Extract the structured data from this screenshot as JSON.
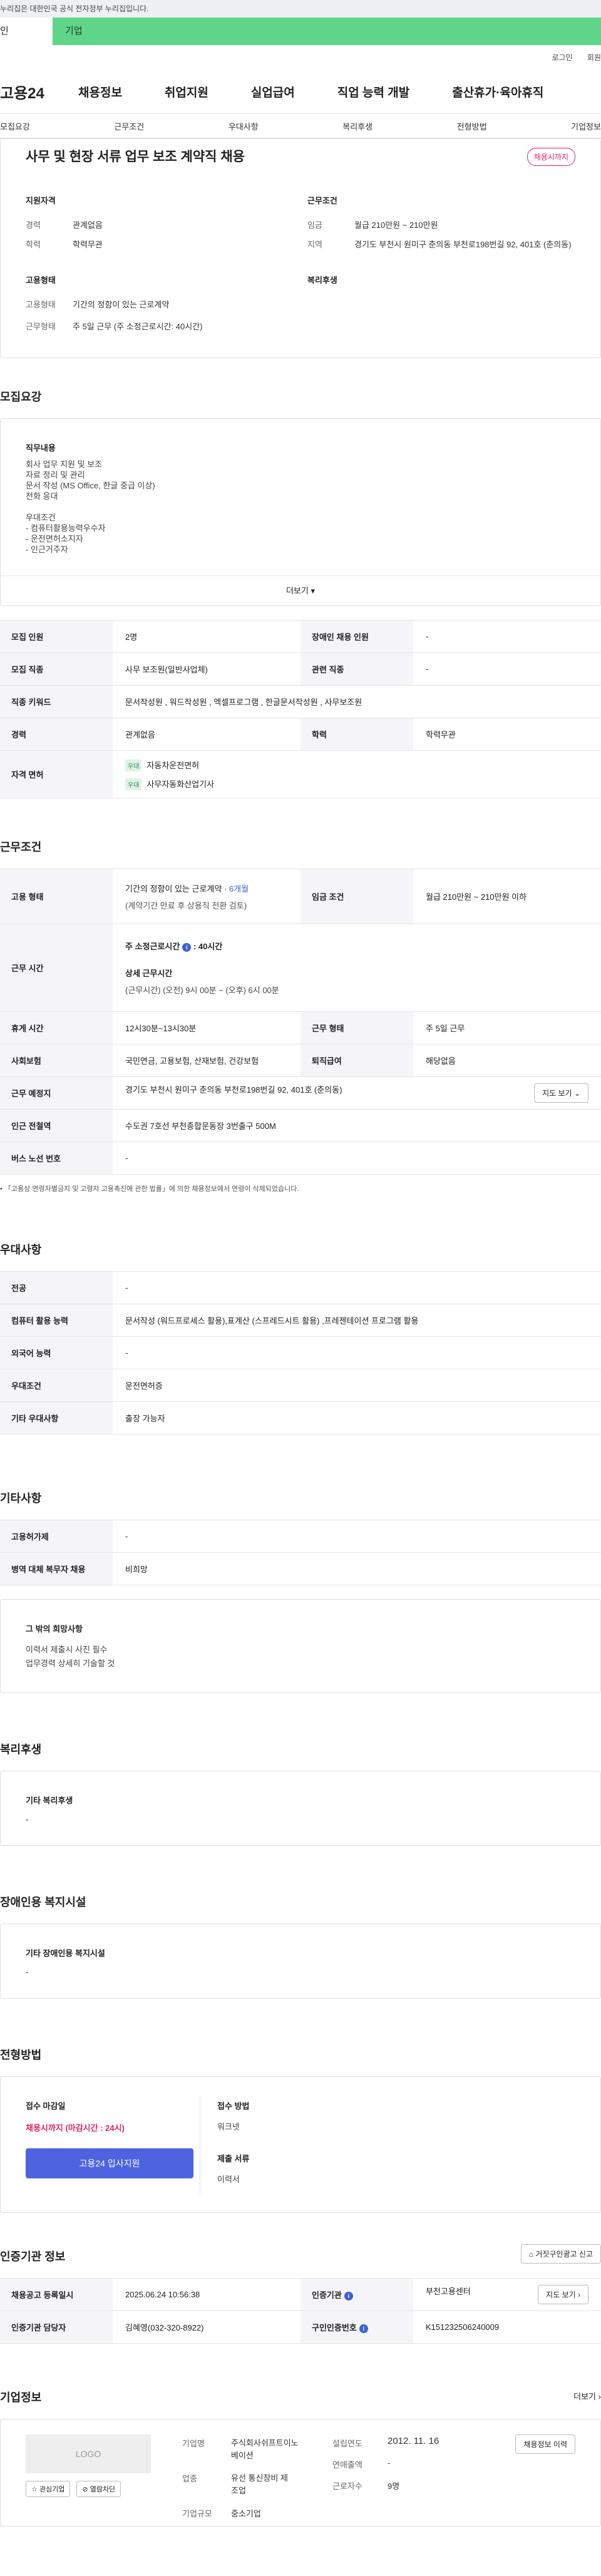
{
  "gov_banner": "누리집은 대한민국 공식 전자정부 누리집입니다.",
  "userbar": {
    "individual": "인",
    "business": "기업"
  },
  "util": {
    "login": "로그인",
    "signup": "회원"
  },
  "gnb": {
    "logo": "고용24",
    "menu": [
      "채용정보",
      "취업지원",
      "실업급여",
      "직업 능력 개발",
      "출산휴가·육아휴직"
    ]
  },
  "tabs": [
    "모집요강",
    "근무조건",
    "우대사항",
    "복리후생",
    "전형방법",
    "기업정보"
  ],
  "job": {
    "title": "사무 및 현장 서류 업무 보조 계약직 채용",
    "status": "채용시까지",
    "qual_title": "지원자격",
    "qual_exp_k": "경력",
    "qual_exp_v": "관계없음",
    "qual_edu_k": "학력",
    "qual_edu_v": "학력무관",
    "cond_title": "근무조건",
    "cond_pay_k": "임금",
    "cond_pay_v": "월급 210만원 ~ 210만원",
    "cond_loc_k": "지역",
    "cond_loc_v": "경기도 부천시 원미구 춘의동 부천로198번길 92, 401호 (춘의동)",
    "emp_title": "고용형태",
    "emp_type_k": "고용형태",
    "emp_type_v": "기간의 정함이 있는 근로계약",
    "emp_time_k": "근무형태",
    "emp_time_v": "주 5일 근무 (주 소정근로시간: 40시간)",
    "welfare_title": "복리후생"
  },
  "recruit": {
    "title": "모집요강",
    "duty_title": "직무내용",
    "duty_lines": [
      "회사 업무 지원 및 보조",
      "자료 정리 및 관리",
      "문서 작성 (MS Office, 한글 중급 이상)",
      "전화 응대",
      "",
      "우대조건",
      "- 컴퓨터활용능력우수자",
      "- 운전면허소지자",
      "- 인근거주자"
    ],
    "more": "더보기",
    "rows": {
      "count_k": "모집 인원",
      "count_v": "2명",
      "disabled_k": "장애인 채용 인원",
      "disabled_v": "-",
      "job_k": "모집 직종",
      "job_v": "사무 보조원(일반사업체)",
      "related_k": "관련 직종",
      "related_v": "-",
      "kw_k": "직종 키워드",
      "kw_v": "문서작성원 , 워드작성원 , 엑셀프로그램 , 한글문서작성원 , 사무보조원",
      "exp_k": "경력",
      "exp_v": "관계없음",
      "edu_k": "학력",
      "edu_v": "학력무관",
      "lic_k": "자격 면허",
      "lic_tag": "우대",
      "lic1": "자동차운전면허",
      "lic2": "사무자동화산업기사"
    }
  },
  "work": {
    "title": "근무조건",
    "emp_k": "고용 형태",
    "emp_v1": "기간의 정함이 있는 근로계약 · ",
    "emp_v1b": "6개월",
    "emp_v2": "(계약기간 만료 후 상용직 전환 검토)",
    "pay_k": "임금 조건",
    "pay_v": "월급 210만원 ~ 210만원 이하",
    "hours_k": "근무 시간",
    "hours_a": "주 소정근로시간",
    "hours_a_v": ": 40시간",
    "hours_b": "상세 근무시간",
    "hours_b_v": "(근무시간) (오전) 9시 00분 ~ (오후) 6시 00분",
    "rest_k": "휴게 시간",
    "rest_v": "12시30분~13시30분",
    "form_k": "근무 형태",
    "form_v": "주 5일 근무",
    "ins_k": "사회보험",
    "ins_v": "국민연금, 고용보험, 산재보험, 건강보험",
    "sev_k": "퇴직급여",
    "sev_v": "해당없음",
    "loc_k": "근무 예정지",
    "loc_v": "경기도 부천시 원미구 춘의동 부천로198번길 92, 401호 (춘의동)",
    "map": "지도 보기",
    "subway_k": "인근 전철역",
    "subway_v": "수도권 7호선 부천종합운동장 3번출구 500M",
    "bus_k": "버스 노선 번호",
    "bus_v": "-",
    "note": "「고용상 연령차별금지 및 고령자 고용촉진에 관한 법률」에 의한 채용정보에서 연령이 삭제되었습니다."
  },
  "pref": {
    "title": "우대사항",
    "major_k": "전공",
    "major_v": "-",
    "comp_k": "컴퓨터 활용 능력",
    "comp_v": "문서작성 (워드프로세스 활용),표계산 (스프레드시트 활용) ,프레젠테이션 프로그램 활용",
    "lang_k": "외국어 능력",
    "lang_v": "-",
    "cond_k": "우대조건",
    "cond_v": "운전면허증",
    "etc_k": "기타 우대사항",
    "etc_v": "출장 가능자"
  },
  "etc": {
    "title": "기타사항",
    "support_k": "고용허가제",
    "support_v": "-",
    "mil_k": "병역 대체 복무자 채용",
    "mil_v": "비희망",
    "other_title": "그 밖의 희망사항",
    "other_lines": [
      "이력서 제출시 사진 필수",
      "업무경력 상세히 기술할 것"
    ]
  },
  "welfare": {
    "title": "복리후생",
    "box_title": "기타 복리후생",
    "box_v": "-"
  },
  "disabled": {
    "title": "장애인용 복지시설",
    "box_title": "기타 장애인용 복지시설",
    "box_v": "-"
  },
  "apply": {
    "title": "전형방법",
    "deadline_title": "접수 마감일",
    "deadline_v": "채용시까지 (마감시간 : 24시)",
    "apply_btn": "고용24 입사지원",
    "method_title": "접수 방법",
    "method_v": "워크넷",
    "docs_title": "제출 서류",
    "docs_v": "이력서"
  },
  "cert": {
    "title": "인증기관 정보",
    "report": "거짓구인광고 신고",
    "reg_k": "채용공고 등록일시",
    "reg_v": "2025.06.24 10:56:38",
    "org_k": "인증기관",
    "org_v": "부천고용센터",
    "map": "지도 보기",
    "mgr_k": "인증기관 담당자",
    "mgr_v": "김혜영(032-320-8922)",
    "num_k": "구인인증번호",
    "num_v": "K151232506240009"
  },
  "company": {
    "title": "기업정보",
    "more": "더보기",
    "logo": "LOGO",
    "fav": "관심기업",
    "block": "열람차단",
    "name_k": "기업명",
    "name_v1": "주식회사쉬프트이노",
    "name_v2": "베이션",
    "ind_k": "업종",
    "ind_v1": "유선 통신장비 제",
    "ind_v2": "조업",
    "size_k": "기업규모",
    "size_v": "중소기업",
    "est_k": "설립연도",
    "est_v": "2012. 11. 16",
    "sales_k": "연매출액",
    "sales_v": "-",
    "emp_k": "근로자수",
    "emp_v": "9명",
    "jobs_btn": "채용정보 이력"
  }
}
